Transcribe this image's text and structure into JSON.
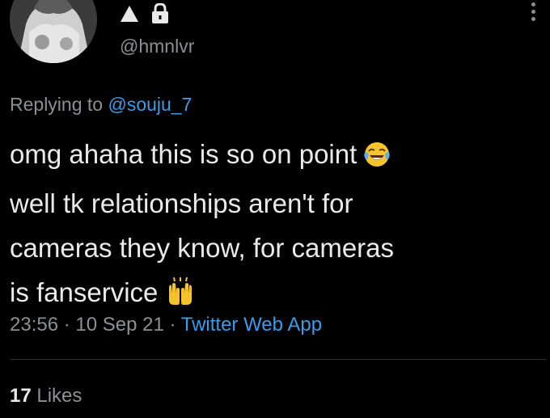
{
  "tweet": {
    "author": {
      "handle": "@hmnlvr",
      "badges": [
        "warning-triangle-icon",
        "lock-icon"
      ]
    },
    "reply": {
      "prefix": "Replying to",
      "mention": "@souju_7"
    },
    "text_lines": [
      "omg ahaha this is so on point",
      "well tk relationships  aren't for",
      "cameras they know, for cameras",
      "is fanservice"
    ],
    "emojis": [
      "tears-of-joy-emoji",
      "raising-hands-emoji"
    ],
    "meta": {
      "time": "23:56",
      "sep1": " · ",
      "date": "10 Sep 21",
      "sep2": " · ",
      "source": "Twitter Web App"
    },
    "likes": {
      "count": "17",
      "label": "Likes"
    }
  },
  "colors": {
    "background": "#000000",
    "text": "#e7e9ea",
    "secondary": "#8b9096",
    "link": "#3a9ce8"
  }
}
